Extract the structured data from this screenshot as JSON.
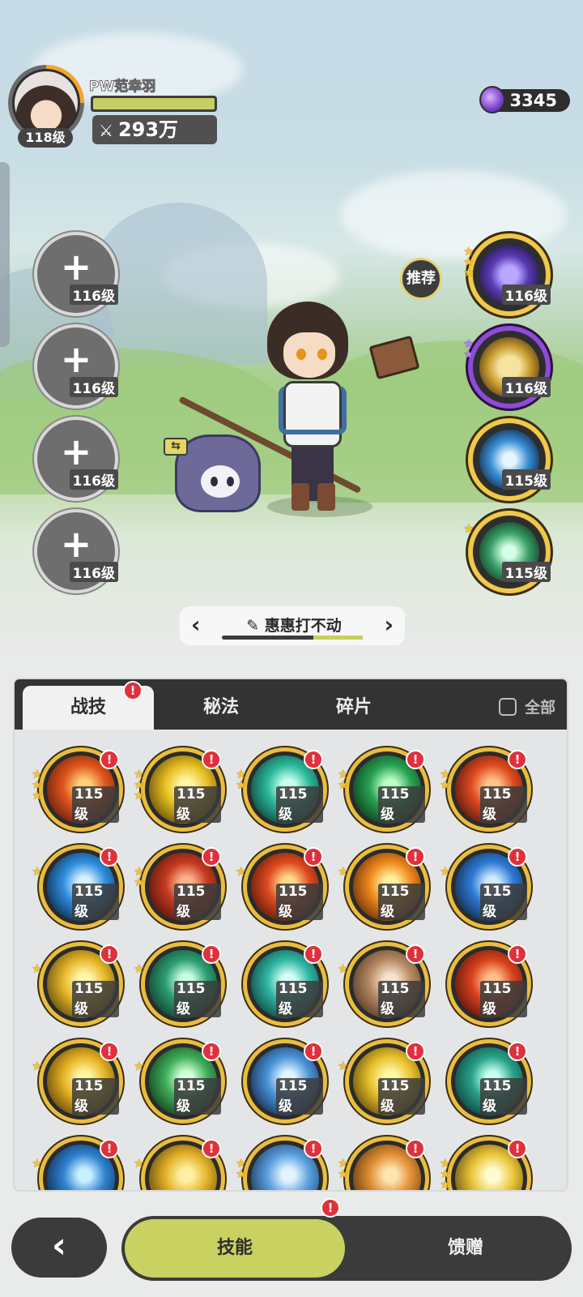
{
  "player": {
    "name": "PW范幸羽",
    "level": "118级",
    "power": "293万",
    "power_icon": "swords-icon",
    "hp_fraction": 1.0
  },
  "currency": {
    "icon": "purple-gem-icon",
    "amount": "3345"
  },
  "recommend_label": "推荐",
  "left_slots": [
    {
      "level": "116级"
    },
    {
      "level": "116级"
    },
    {
      "level": "116级"
    },
    {
      "level": "116级"
    }
  ],
  "right_slots": [
    {
      "level": "116级",
      "icon": "clock-icon",
      "stars": 3,
      "star_color": "gold"
    },
    {
      "level": "116级",
      "icon": "shield-icon",
      "stars": 2,
      "star_color": "purple"
    },
    {
      "level": "115级",
      "icon": "crystal-icon",
      "stars": 0,
      "star_color": "gold"
    },
    {
      "level": "115级",
      "icon": "green-shield-icon",
      "stars": 1,
      "star_color": "gold"
    }
  ],
  "loadout": {
    "name": "惠惠打不动",
    "prev_icon": "chevron-left-icon",
    "next_icon": "chevron-right-icon",
    "edit_icon": "pencil-icon"
  },
  "tabs": {
    "skills": "战技",
    "secret": "秘法",
    "fragments": "碎片",
    "all": "全部"
  },
  "badge_mark": "!",
  "skills": [
    {
      "level": "115级",
      "stars": 3,
      "icon": "fire-burst-icon"
    },
    {
      "level": "115级",
      "stars": 3,
      "icon": "lightning-orb-icon"
    },
    {
      "level": "115级",
      "stars": 2,
      "icon": "wind-slash-icon"
    },
    {
      "level": "115级",
      "stars": 2,
      "icon": "healing-cross-icon"
    },
    {
      "level": "115级",
      "stars": 2,
      "icon": "flame-swirl-icon"
    },
    {
      "level": "115级",
      "stars": 1,
      "icon": "ice-shard-icon"
    },
    {
      "level": "115级",
      "stars": 2,
      "icon": "fire-meteor-icon"
    },
    {
      "level": "115级",
      "stars": 1,
      "icon": "fire-orb-icon"
    },
    {
      "level": "115级",
      "stars": 1,
      "icon": "fire-explosion-icon"
    },
    {
      "level": "115级",
      "stars": 1,
      "icon": "water-splash-icon"
    },
    {
      "level": "115级",
      "stars": 1,
      "icon": "light-burst-icon"
    },
    {
      "level": "115级",
      "stars": 1,
      "icon": "thorn-vine-icon"
    },
    {
      "level": "115级",
      "stars": 0,
      "icon": "whirlpool-icon"
    },
    {
      "level": "115级",
      "stars": 1,
      "icon": "stone-cards-icon"
    },
    {
      "level": "115级",
      "stars": 0,
      "icon": "flame-blast-icon"
    },
    {
      "level": "115级",
      "stars": 1,
      "icon": "golden-lightning-icon"
    },
    {
      "level": "115级",
      "stars": 1,
      "icon": "green-wind-icon"
    },
    {
      "level": "115级",
      "stars": 0,
      "icon": "ice-spikes-icon"
    },
    {
      "level": "115级",
      "stars": 1,
      "icon": "sun-triangle-icon"
    },
    {
      "level": "115级",
      "stars": 0,
      "icon": "green-orb-icon"
    },
    {
      "level": "",
      "stars": 1,
      "icon": "blue-vortex-icon"
    },
    {
      "level": "",
      "stars": 1,
      "icon": "golden-prism-icon"
    },
    {
      "level": "",
      "stars": 2,
      "icon": "ice-star-icon"
    },
    {
      "level": "",
      "stars": 2,
      "icon": "star-slash-icon"
    },
    {
      "level": "",
      "stars": 3,
      "icon": "golden-sparkle-icon"
    }
  ],
  "bottom": {
    "back_icon": "chevron-left-icon",
    "skills": "技能",
    "gift": "馈赠"
  }
}
